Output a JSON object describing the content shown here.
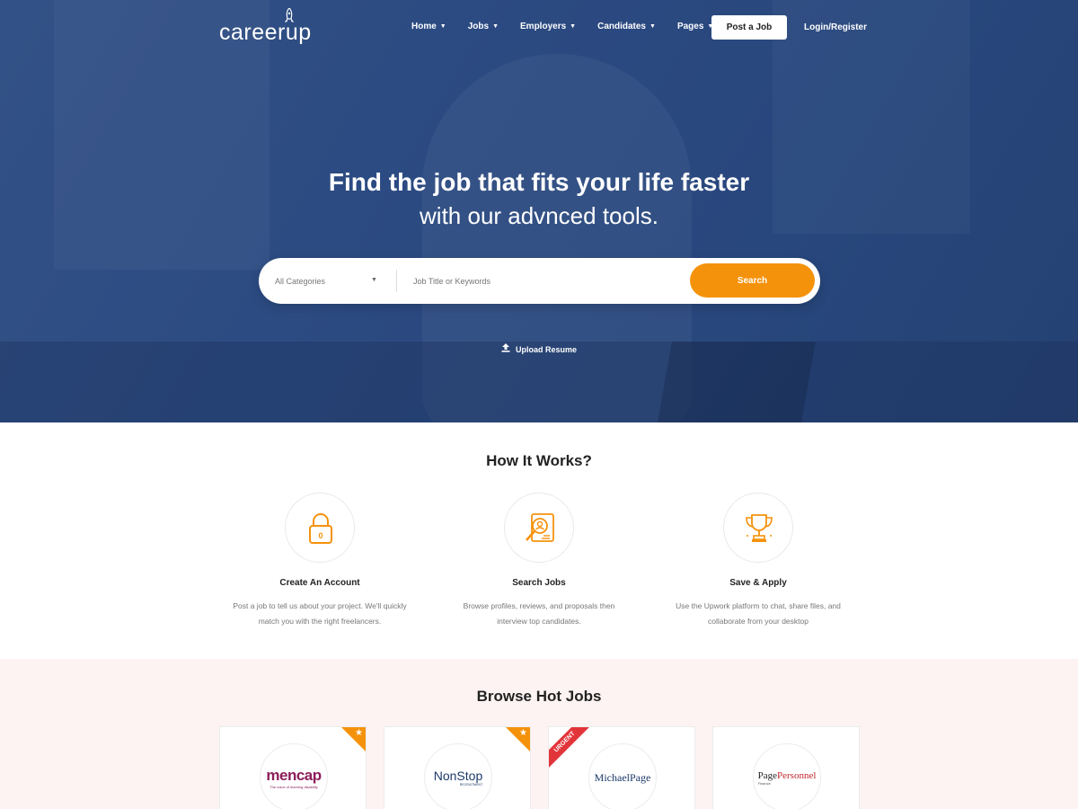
{
  "header": {
    "logo": "careerup",
    "nav": [
      {
        "label": "Home"
      },
      {
        "label": "Jobs"
      },
      {
        "label": "Employers"
      },
      {
        "label": "Candidates"
      },
      {
        "label": "Pages"
      }
    ],
    "post_job": "Post a Job",
    "login": "Login/Register"
  },
  "hero": {
    "headline_line1": "Find the job that fits your life faster",
    "headline_line2": "with our advnced tools.",
    "search": {
      "category_value": "All Categories",
      "keywords_placeholder": "Job Title or Keywords",
      "button": "Search"
    },
    "upload_resume": "Upload Resume"
  },
  "how_it_works": {
    "title": "How It Works?",
    "steps": [
      {
        "icon": "lock-icon",
        "title": "Create An Account",
        "desc_line1": "Post a job to tell us about your project. We'll quickly",
        "desc_line2": "match you with the right freelancers."
      },
      {
        "icon": "search-document-icon",
        "title": "Search Jobs",
        "desc_line1": "Browse profiles, reviews, and proposals then",
        "desc_line2": "interview top candidates."
      },
      {
        "icon": "trophy-icon",
        "title": "Save & Apply",
        "desc_line1": "Use the Upwork platform to chat, share files, and",
        "desc_line2": "collaborate from your desktop"
      }
    ]
  },
  "browse": {
    "title": "Browse Hot Jobs",
    "cards": [
      {
        "company": "mencap",
        "tagline": "The voice of learning disability",
        "badge": "star"
      },
      {
        "company": "NonStop",
        "tagline": "RECRUITMENT",
        "badge": "star"
      },
      {
        "company": "MichaelPage",
        "badge": "urgent",
        "badge_label": "URGENT"
      },
      {
        "company_part1": "Page",
        "company_part2": "Personnel",
        "tagline": "Finance"
      }
    ]
  },
  "colors": {
    "accent": "#f5920c",
    "hero_blue": "#2f4f86",
    "urgent": "#e2353a",
    "browse_bg": "#fdf3f2"
  }
}
